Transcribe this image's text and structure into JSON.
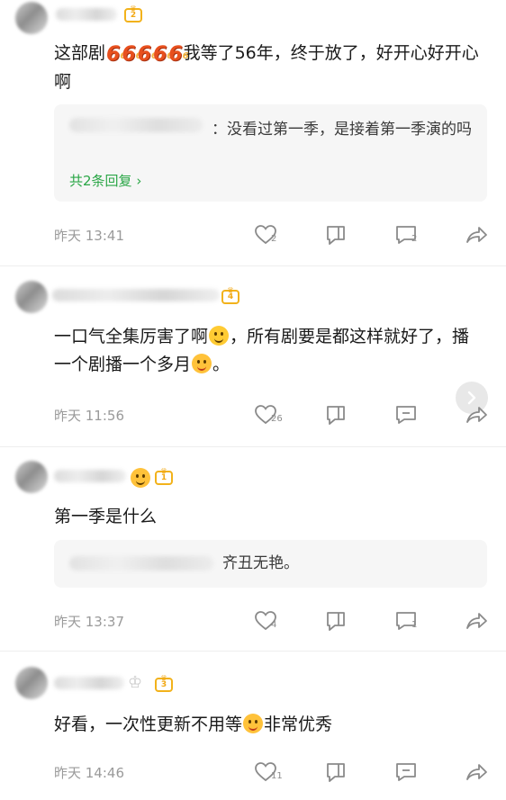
{
  "comments": [
    {
      "text_before": "这部剧",
      "emoji_six": [
        "6",
        "6",
        "6",
        "6",
        "6"
      ],
      "text_after": "我等了56年，终于放了，好开心好开心啊",
      "reply_preview": "：没看过第一季，是接着第一季演的吗",
      "more_replies": "共2条回复",
      "time": "昨天 13:41",
      "likes": "2",
      "replies": "2",
      "badge_level": "2"
    },
    {
      "text_part1": "一口气全集厉害了啊",
      "text_part2": "，所有剧要是都这样就好了，播一个剧播一个多月",
      "text_part3": "。",
      "time": "昨天 11:56",
      "likes": "26",
      "badge_level": "4"
    },
    {
      "text": "第一季是什么",
      "reply_preview": "齐丑无艳。",
      "time": "昨天 13:37",
      "likes": "4",
      "replies": "1",
      "badge_level": "1"
    },
    {
      "text_part1": "好看，一次性更新不用等",
      "text_part2": "非常优秀",
      "time": "昨天 14:46",
      "likes": "11",
      "badge_level": "3"
    }
  ],
  "icons": {
    "like": "heart-outline-icon",
    "dislike": "dislike-icon",
    "reply": "comment-bubble-icon",
    "share": "share-arrow-icon",
    "next": "chevron-right-icon"
  },
  "colors": {
    "reply_link": "#2aa646",
    "badge": "#f2b21b",
    "time": "#9a9a9a"
  }
}
